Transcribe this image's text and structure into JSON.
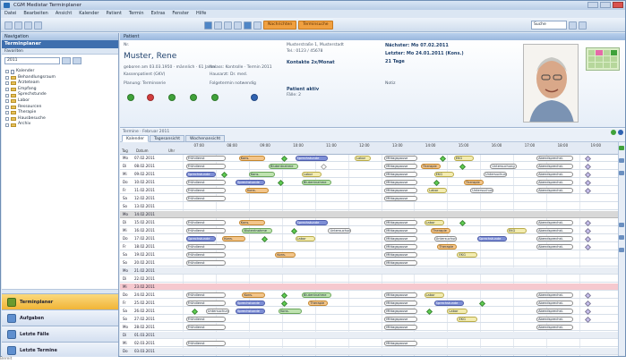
{
  "window": {
    "title": "CGM Medistar Terminplaner"
  },
  "menu": [
    "Datei",
    "Bearbeiten",
    "Ansicht",
    "Kalender",
    "Patient",
    "Termin",
    "Extras",
    "Fenster",
    "Hilfe"
  ],
  "toolbar": {
    "orange1": "Nachrichten",
    "orange2": "Terminsuche",
    "search_placeholder": "Suche"
  },
  "left": {
    "header": "Navigation",
    "section": "Terminplaner",
    "subsection": "Favoriten",
    "search_value": "2011",
    "tree": [
      {
        "label": "Kalender",
        "indent": false,
        "icon": "doc"
      },
      {
        "label": "Behandlungsraum",
        "indent": false,
        "icon": "folder"
      },
      {
        "label": "Ärzteteam",
        "indent": false,
        "icon": "folder"
      },
      {
        "label": "Empfang",
        "indent": false,
        "icon": "folder"
      },
      {
        "label": "Sprechstunde",
        "indent": false,
        "icon": "folder"
      },
      {
        "label": "Labor",
        "indent": false,
        "icon": "folder"
      },
      {
        "label": "Ressourcen",
        "indent": false,
        "icon": "folder"
      },
      {
        "label": "Therapie",
        "indent": false,
        "icon": "folder"
      },
      {
        "label": "Hausbesuche",
        "indent": false,
        "icon": "folder"
      },
      {
        "label": "Archiv",
        "indent": false,
        "icon": "folder"
      }
    ],
    "nav": [
      {
        "label": "Terminplaner",
        "active": true
      },
      {
        "label": "Aufgaben",
        "active": false
      },
      {
        "label": "Letzte Fälle",
        "active": false
      },
      {
        "label": "Letzte Termine",
        "active": false
      }
    ]
  },
  "main": {
    "header": "Patient",
    "patient": {
      "id": "Nr.",
      "name": "Muster, Rene",
      "born": "geboren am 03.03.1950 · männlich · 61 Jahre",
      "insurance": "Kassenpatient (GKV)",
      "kvk": "Anlass: Kontrolle · Termin 2011",
      "doctor": "Hausarzt: Dr. med.",
      "address": "Musterstraße 1, Musterstadt",
      "phone_label": "Tel.: 0123 / 45678",
      "freq": "Kontakte 2x/Monat",
      "status": "Patient aktiv",
      "count": "Fälle: 2",
      "appt1_label": "Nächster: Mo 07.02.2011",
      "appt2_label": "Letzter: Mo 24.01.2011 (Kons.)",
      "days_label": "21 Tage",
      "kvs_value": "Folgetermin notwendig",
      "next_label": "Planung: Terminserie",
      "note": "Notiz"
    },
    "tabsbar": {
      "breadcrumb": "Termine · Februar 2011",
      "tabs": [
        "Kalender",
        "Tagesansicht",
        "Wochenansicht"
      ]
    },
    "grid": {
      "headers": [
        "Tag",
        "Datum",
        "Uhr"
      ],
      "times": [
        "07:00",
        "08:00",
        "09:00",
        "10:00",
        "11:00",
        "12:00",
        "13:00",
        "14:00",
        "15:00",
        "16:00",
        "17:00",
        "18:00",
        "19:00"
      ],
      "rows": [
        {
          "d": "Mo",
          "date": "07.02.2011",
          "type": "normal"
        },
        {
          "d": "Di",
          "date": "08.02.2011",
          "type": "normal"
        },
        {
          "d": "Mi",
          "date": "09.02.2011",
          "type": "normal"
        },
        {
          "d": "Do",
          "date": "10.02.2011",
          "type": "normal"
        },
        {
          "d": "Fr",
          "date": "11.02.2011",
          "type": "normal"
        },
        {
          "d": "Sa",
          "date": "12.02.2011",
          "type": "normal"
        },
        {
          "d": "So",
          "date": "13.02.2011",
          "type": "normal"
        },
        {
          "d": "Mo",
          "date": "14.02.2011",
          "type": "week"
        },
        {
          "d": "Di",
          "date": "15.02.2011",
          "type": "normal"
        },
        {
          "d": "Mi",
          "date": "16.02.2011",
          "type": "normal"
        },
        {
          "d": "Do",
          "date": "17.02.2011",
          "type": "normal"
        },
        {
          "d": "Fr",
          "date": "18.02.2011",
          "type": "normal"
        },
        {
          "d": "Sa",
          "date": "19.02.2011",
          "type": "normal"
        },
        {
          "d": "So",
          "date": "20.02.2011",
          "type": "normal"
        },
        {
          "d": "Mo",
          "date": "21.02.2011",
          "type": "band"
        },
        {
          "d": "Di",
          "date": "22.02.2011",
          "type": "normal"
        },
        {
          "d": "Mi",
          "date": "23.02.2011",
          "type": "pink"
        },
        {
          "d": "Do",
          "date": "24.02.2011",
          "type": "normal"
        },
        {
          "d": "Fr",
          "date": "25.02.2011",
          "type": "normal"
        },
        {
          "d": "Sa",
          "date": "26.02.2011",
          "type": "normal"
        },
        {
          "d": "So",
          "date": "27.02.2011",
          "type": "normal"
        },
        {
          "d": "Mo",
          "date": "28.02.2011",
          "type": "normal"
        },
        {
          "d": "Di",
          "date": "01.03.2011",
          "type": "band"
        },
        {
          "d": "Mi",
          "date": "02.03.2011",
          "type": "normal"
        },
        {
          "d": "Do",
          "date": "03.03.2011",
          "type": "band"
        }
      ],
      "pill_labels": {
        "fp": "Frühdienst",
        "sp": "Sprechstunde",
        "bt": "Blutentnahme",
        "mp": "Mittagspause",
        "kons": "Kons.",
        "lab": "Labor",
        "ekg": "EKG",
        "abs": "Abendsprechst.",
        "th": "Therapie",
        "x": "Untersuchung"
      }
    }
  },
  "colors": {
    "accent": "#3f6fae",
    "orange": "#f0a040",
    "green": "#5fcf52",
    "pink": "#f6c9cf"
  },
  "statusbar": "Bereit"
}
